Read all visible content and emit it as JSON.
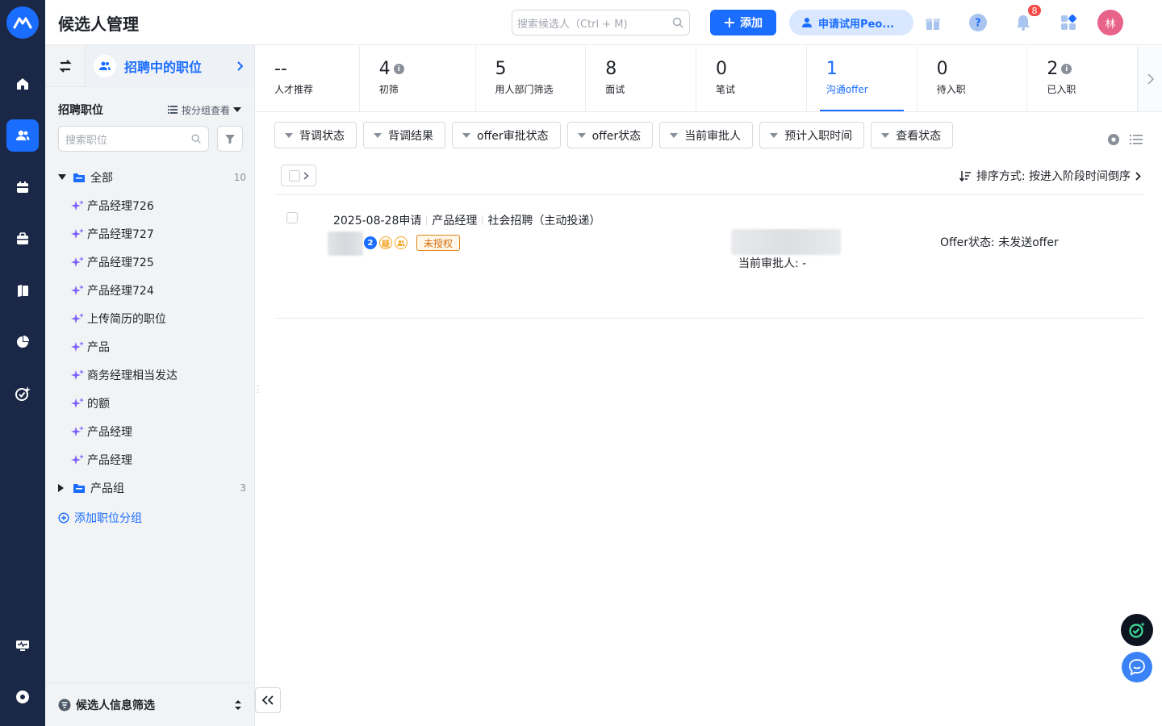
{
  "header": {
    "title": "候选人管理",
    "search_placeholder": "搜索候选人（Ctrl + M)",
    "add_label": "添加",
    "trial_label": "申请试用Peo...",
    "notification_count": "8",
    "avatar_initial": "林"
  },
  "sidebar": {
    "current_view": "招聘中的职位",
    "section_title": "招聘职位",
    "group_view_label": "按分组查看",
    "search_placeholder": "搜索职位",
    "tree": {
      "root": {
        "label": "全部",
        "count": "10"
      },
      "items": [
        "产品经理726",
        "产品经理727",
        "产品经理725",
        "产品经理724",
        "上传简历的职位",
        "产品",
        "商务经理相当发达",
        "的额",
        "产品经理",
        "产品经理"
      ],
      "group": {
        "label": "产品组",
        "count": "3"
      }
    },
    "add_group_label": "添加职位分组",
    "footer_label": "候选人信息筛选"
  },
  "stages": [
    {
      "count": "--",
      "label": "人才推荐"
    },
    {
      "count": "4",
      "label": "初筛"
    },
    {
      "count": "5",
      "label": "用人部门筛选"
    },
    {
      "count": "8",
      "label": "面试"
    },
    {
      "count": "0",
      "label": "笔试"
    },
    {
      "count": "1",
      "label": "沟通offer"
    },
    {
      "count": "0",
      "label": "待入职"
    },
    {
      "count": "2",
      "label": "已入职"
    }
  ],
  "filters": [
    "背调状态",
    "背调结果",
    "offer审批状态",
    "offer状态",
    "当前审批人",
    "预计入职时间",
    "查看状态"
  ],
  "sort_label": "排序方式: 按进入阶段时间倒序",
  "candidate": {
    "applied": "2025-08-28申请",
    "position": "产品经理",
    "channel": "社会招聘（主动投递）",
    "badge_num": "2",
    "badge_doubt": "疑",
    "unauthorized": "未授权",
    "approver": "当前审批人: -",
    "offer_status": "Offer状态:  未发送offer"
  },
  "colors": {
    "accent": "#1a6dff",
    "rail": "#1b2746",
    "warning": "#d46b08"
  }
}
